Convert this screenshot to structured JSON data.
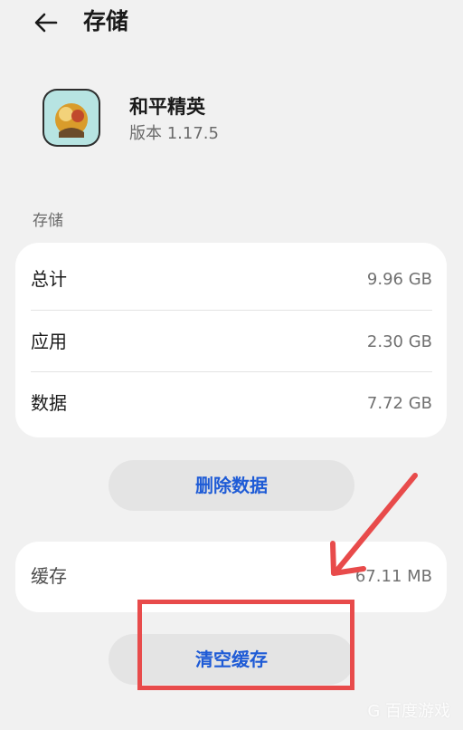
{
  "header": {
    "title": "存储"
  },
  "app": {
    "name": "和平精英",
    "version": "版本 1.17.5"
  },
  "storage": {
    "section_label": "存储",
    "rows": [
      {
        "label": "总计",
        "value": "9.96 GB"
      },
      {
        "label": "应用",
        "value": "2.30 GB"
      },
      {
        "label": "数据",
        "value": "7.72 GB"
      }
    ],
    "delete_button": "删除数据"
  },
  "cache": {
    "label": "缓存",
    "value": "67.11 MB",
    "clear_button": "清空缓存"
  },
  "annotation": {
    "color": "#e84b4b"
  },
  "watermark": {
    "text": "百度游戏"
  },
  "icons": {
    "back": "back-arrow-icon",
    "app": "app-icon",
    "annotation_arrow": "annotation-arrow-icon",
    "watermark_logo": "watermark-logo-icon"
  },
  "colors": {
    "background": "#f1f1f1",
    "card": "#ffffff",
    "button_bg": "#e4e4e4",
    "accent_blue": "#1e5bd6",
    "annotation_red": "#e84b4b"
  }
}
